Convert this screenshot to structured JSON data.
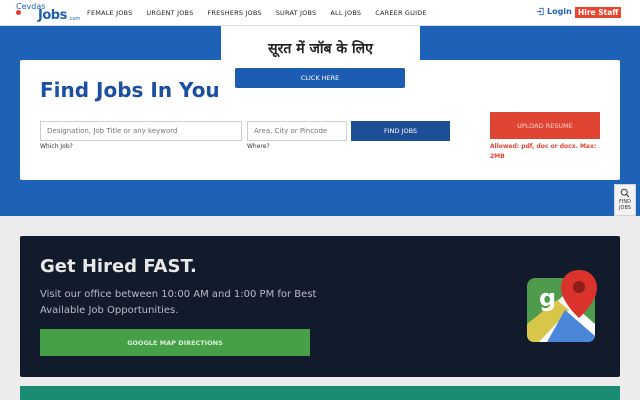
{
  "nav": {
    "logo": {
      "prefix": "Cevdas",
      "main": "Jobs",
      "suffix": ".com"
    },
    "links": [
      "FEMALE JOBS",
      "URGENT JOBS",
      "FRESHERS JOBS",
      "SURAT JOBS",
      "ALL JOBS",
      "CAREER GUIDE"
    ],
    "login": "Login",
    "hire": "Hire Staff"
  },
  "search": {
    "title": "Find Jobs In Your",
    "keyword_placeholder": "Designation, Job Title or any keyword",
    "location_placeholder": "Area, City or Pincode",
    "find_button": "FIND JOBS",
    "which_label": "Which Job?",
    "where_label": "Where?",
    "upload_button": "UPLOAD RESUME",
    "allowed_text": "Allowed: pdf, doc or docx. Max: 2MB"
  },
  "side_tab": {
    "label_line1": "FIND",
    "label_line2": "JOBS"
  },
  "hired": {
    "title": "Get Hired FAST.",
    "text": "Visit our office between 10:00 AM and 1:00 PM for Best Available Job Opportunities.",
    "map_button": "GOOGLE MAP DIRECTIONS"
  },
  "popup": {
    "title": "सूरत में जॉब के लिए",
    "button": "CLICK HERE"
  },
  "colors": {
    "brand_blue": "#1e62b8",
    "hire_red": "#e8472f",
    "dark_card": "#121b2b",
    "map_green": "#46a048",
    "teal": "#1a8c73"
  },
  "icons": [
    "login-icon",
    "search-icon",
    "google-maps-icon"
  ]
}
